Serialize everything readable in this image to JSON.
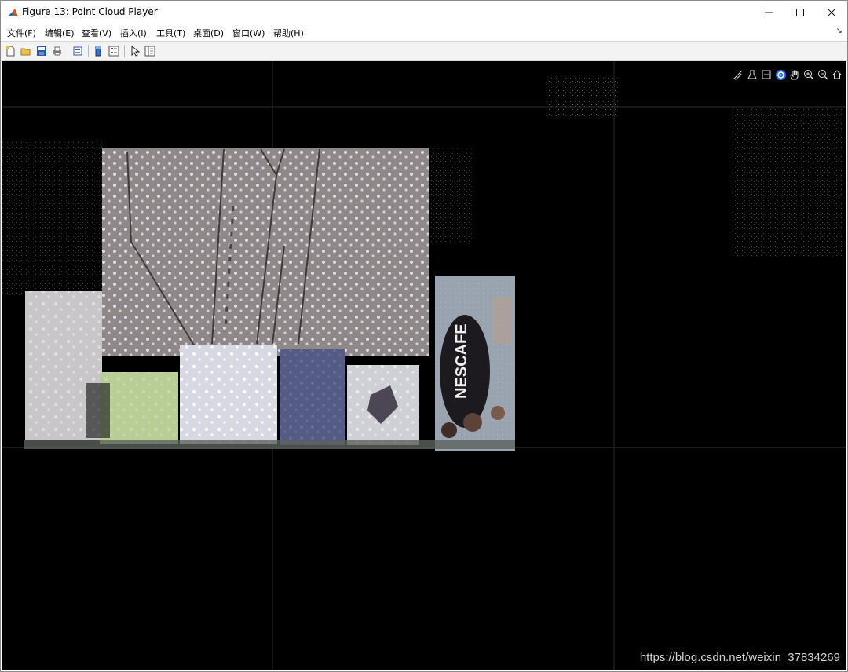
{
  "window": {
    "title": "Figure 13: Point Cloud Player",
    "controls": {
      "minimize_icon": "minimize-icon",
      "maximize_icon": "maximize-icon",
      "close_icon": "close-icon"
    }
  },
  "menubar": {
    "items": [
      {
        "label": "文件(F)"
      },
      {
        "label": "编辑(E)"
      },
      {
        "label": "查看(V)"
      },
      {
        "label": "插入(I)"
      },
      {
        "label": "工具(T)"
      },
      {
        "label": "桌面(D)"
      },
      {
        "label": "窗口(W)"
      },
      {
        "label": "帮助(H)"
      }
    ]
  },
  "toolbar": {
    "icons": [
      "new-figure-icon",
      "open-file-icon",
      "save-icon",
      "print-icon",
      "print-preview-icon",
      "colorbar-icon",
      "legend-icon",
      "pointer-icon",
      "property-inspector-icon"
    ]
  },
  "axes_toolbar": {
    "icons": [
      "brush-icon",
      "data-tips-icon",
      "export-icon",
      "rotate-3d-icon",
      "pan-icon",
      "zoom-in-icon",
      "zoom-out-icon",
      "home-icon"
    ]
  },
  "scene": {
    "object_text": "NESCAFE"
  },
  "watermark": "https://blog.csdn.net/weixin_37834269",
  "colors": {
    "background": "#000000",
    "grid": "#3a3a3a",
    "active_tool": "#2f6fd6"
  }
}
